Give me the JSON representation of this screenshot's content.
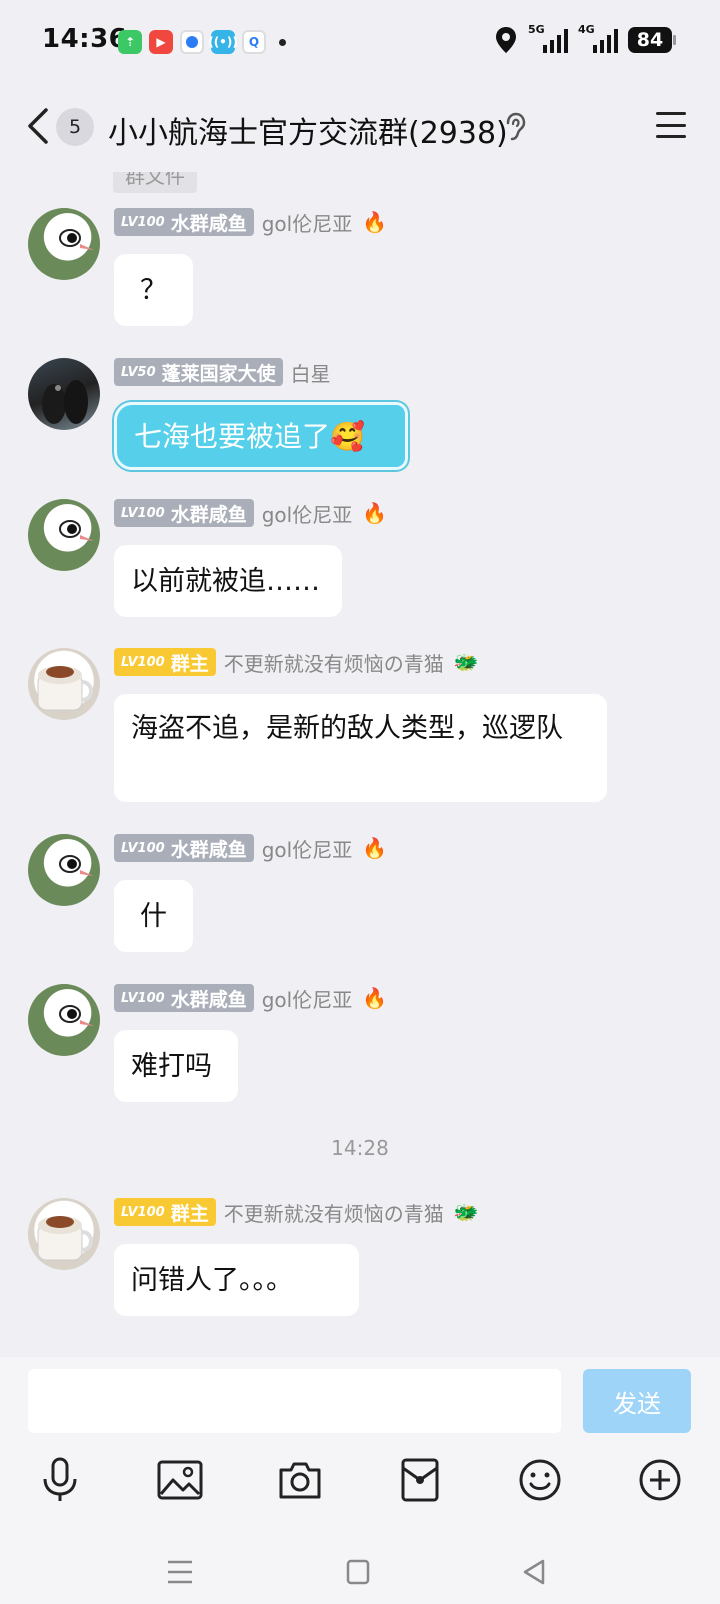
{
  "status_bar": {
    "time": "14:36",
    "signal_1": "5G",
    "signal_2": "4G",
    "battery": "84",
    "app_icons": [
      "green-app-icon",
      "video-app-icon",
      "blue-app-icon",
      "wifi-app-icon",
      "search-app-icon"
    ]
  },
  "nav": {
    "back_icon": "chevron-left-icon",
    "unread_count": "5",
    "title": "小小航海士官方交流群(2938)",
    "ear_icon": "ear-icon",
    "menu_icon": "hamburger-menu-icon"
  },
  "chat": {
    "peek_label": "群文件",
    "messages": [
      {
        "level": "LV100",
        "tag": "水群咸鱼",
        "tag_color": "#a9aeb9",
        "nickname": "gol伦尼亚",
        "nick_icon": "fire-icon",
        "text": "？"
      },
      {
        "level": "LV50",
        "tag": "蓬莱国家大使",
        "tag_color": "#a9aeb9",
        "nickname": "白星",
        "nick_icon": "",
        "text": "七海也要被追了🥰"
      },
      {
        "level": "LV100",
        "tag": "水群咸鱼",
        "tag_color": "#a9aeb9",
        "nickname": "gol伦尼亚",
        "nick_icon": "fire-icon",
        "text": "以前就被追……"
      },
      {
        "level": "LV100",
        "tag": "群主",
        "tag_color": "#f9c934",
        "nickname": "不更新就没有烦恼の青猫",
        "nick_icon": "dragon-icon",
        "text": "海盗不追，是新的敌人类型，巡逻队"
      },
      {
        "level": "LV100",
        "tag": "水群咸鱼",
        "tag_color": "#a9aeb9",
        "nickname": "gol伦尼亚",
        "nick_icon": "fire-icon",
        "text": "什"
      },
      {
        "level": "LV100",
        "tag": "水群咸鱼",
        "tag_color": "#a9aeb9",
        "nickname": "gol伦尼亚",
        "nick_icon": "fire-icon",
        "text": "难打吗"
      },
      {
        "level": "LV100",
        "tag": "群主",
        "tag_color": "#f9c934",
        "nickname": "不更新就没有烦恼の青猫",
        "nick_icon": "dragon-icon",
        "text": "问错人了。。。"
      }
    ],
    "timestamp": "14:28"
  },
  "input": {
    "placeholder": "",
    "send_label": "发送"
  },
  "toolbar": {
    "icons": [
      "microphone-icon",
      "image-icon",
      "camera-icon",
      "red-packet-icon",
      "emoji-icon",
      "plus-icon"
    ]
  },
  "system_nav": {
    "icons": [
      "recent-apps-icon",
      "home-icon",
      "back-triangle-icon"
    ]
  }
}
